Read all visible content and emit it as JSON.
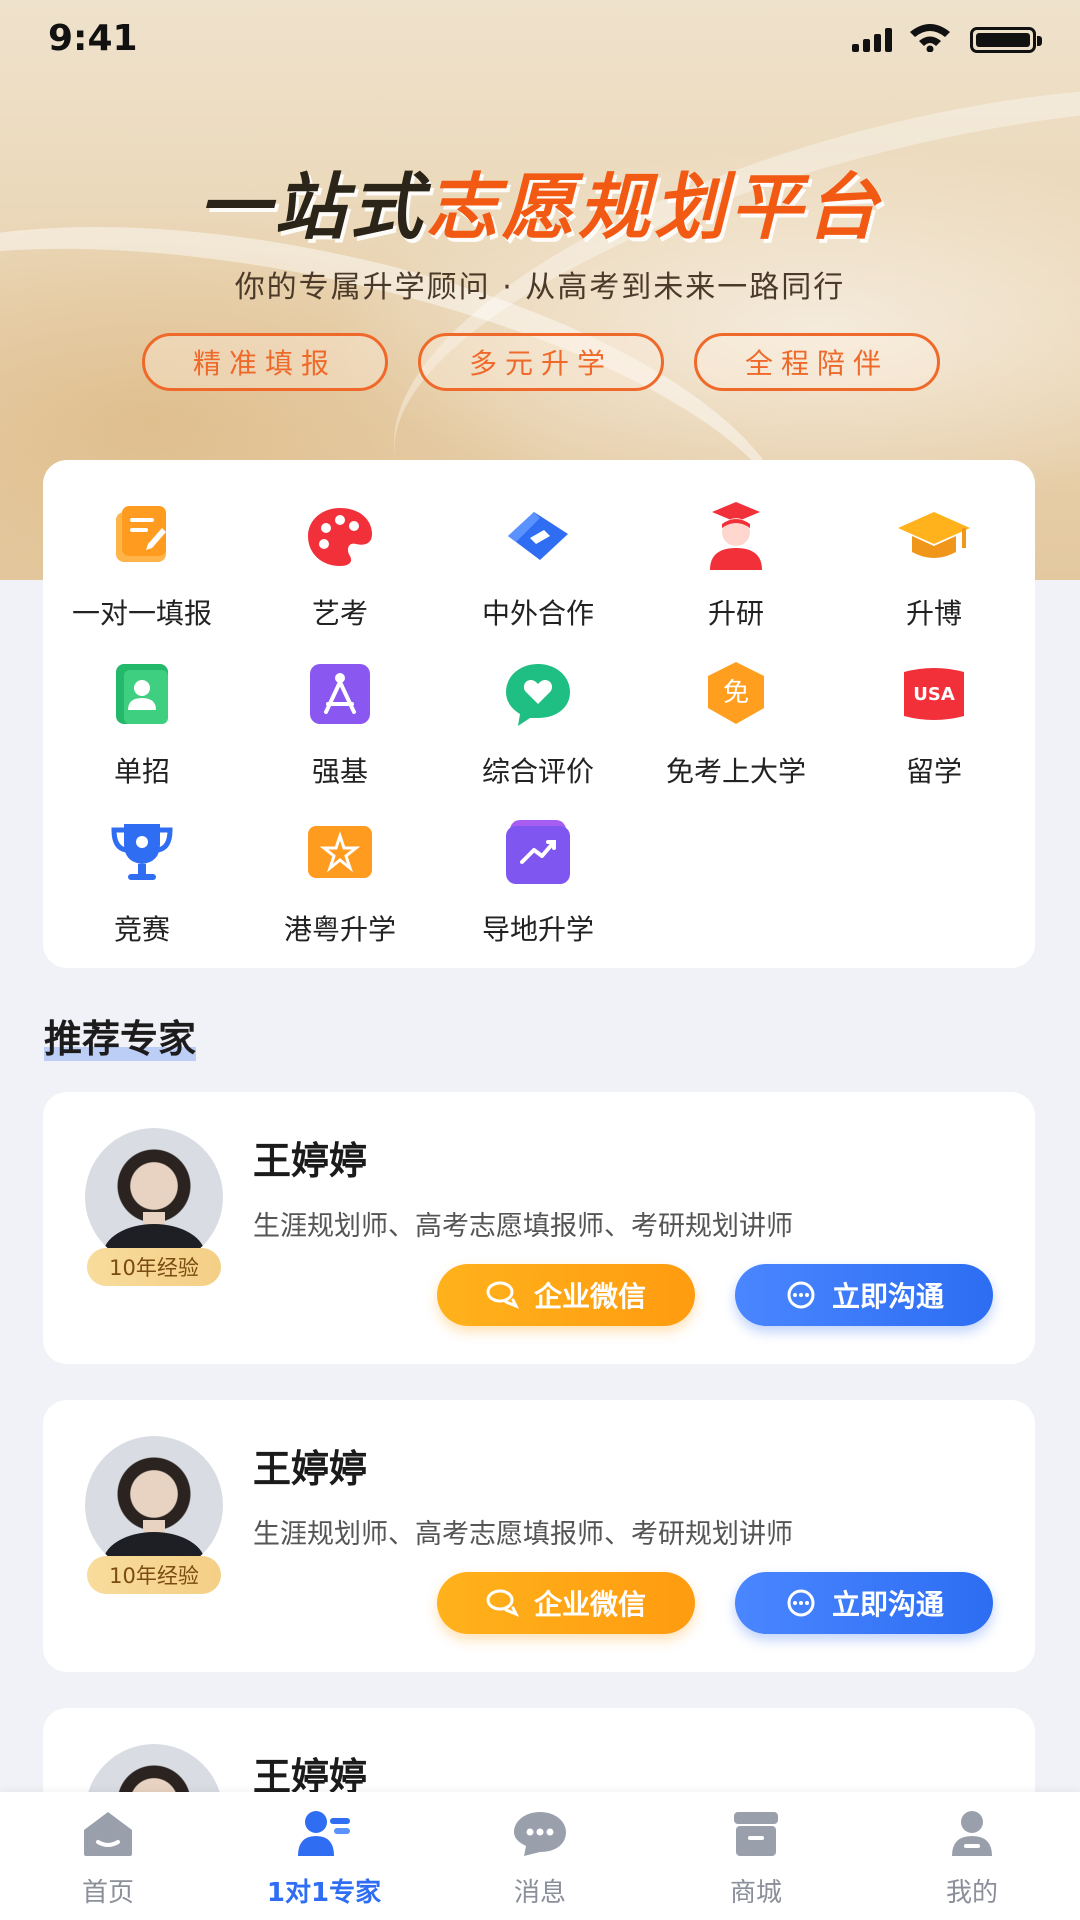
{
  "status_bar": {
    "time": "9:41"
  },
  "banner": {
    "title_part1": "一站式",
    "title_part2": "志愿规划平台",
    "subtitle": "你的专属升学顾问 · 从高考到未来一路同行",
    "pills": [
      "精准填报",
      "多元升学",
      "全程陪伴"
    ]
  },
  "services": [
    {
      "label": "一对一填报",
      "icon": "form-edit-icon"
    },
    {
      "label": "艺考",
      "icon": "palette-icon"
    },
    {
      "label": "中外合作",
      "icon": "handshake-icon"
    },
    {
      "label": "升研",
      "icon": "graduate-icon"
    },
    {
      "label": "升博",
      "icon": "mortarboard-icon"
    },
    {
      "label": "单招",
      "icon": "person-card-icon"
    },
    {
      "label": "强基",
      "icon": "compass-icon"
    },
    {
      "label": "综合评价",
      "icon": "heart-chat-icon"
    },
    {
      "label": "免考上大学",
      "icon": "exempt-badge-icon"
    },
    {
      "label": "留学",
      "icon": "usa-icon"
    },
    {
      "label": "竞赛",
      "icon": "trophy-icon"
    },
    {
      "label": "港粤升学",
      "icon": "bauhinia-icon"
    },
    {
      "label": "导地升学",
      "icon": "trend-icon"
    }
  ],
  "usa_text": "USA",
  "exempt_text": "免",
  "section_title": "推荐专家",
  "experts": [
    {
      "name": "王婷婷",
      "experience": "10年经验",
      "titles": "生涯规划师、高考志愿填报师、考研规划讲师",
      "btn_wechat": "企业微信",
      "btn_chat": "立即沟通"
    },
    {
      "name": "王婷婷",
      "experience": "10年经验",
      "titles": "生涯规划师、高考志愿填报师、考研规划讲师",
      "btn_wechat": "企业微信",
      "btn_chat": "立即沟通"
    },
    {
      "name": "王婷婷"
    }
  ],
  "tabbar": [
    {
      "label": "首页",
      "icon": "home-icon",
      "active": false
    },
    {
      "label": "1对1专家",
      "icon": "expert-icon",
      "active": true
    },
    {
      "label": "消息",
      "icon": "message-icon",
      "active": false
    },
    {
      "label": "商城",
      "icon": "store-icon",
      "active": false
    },
    {
      "label": "我的",
      "icon": "profile-icon",
      "active": false
    }
  ],
  "colors": {
    "accent_orange": "#f25a14",
    "primary_blue": "#2f6ef3",
    "tab_inactive": "#8a8f99"
  }
}
